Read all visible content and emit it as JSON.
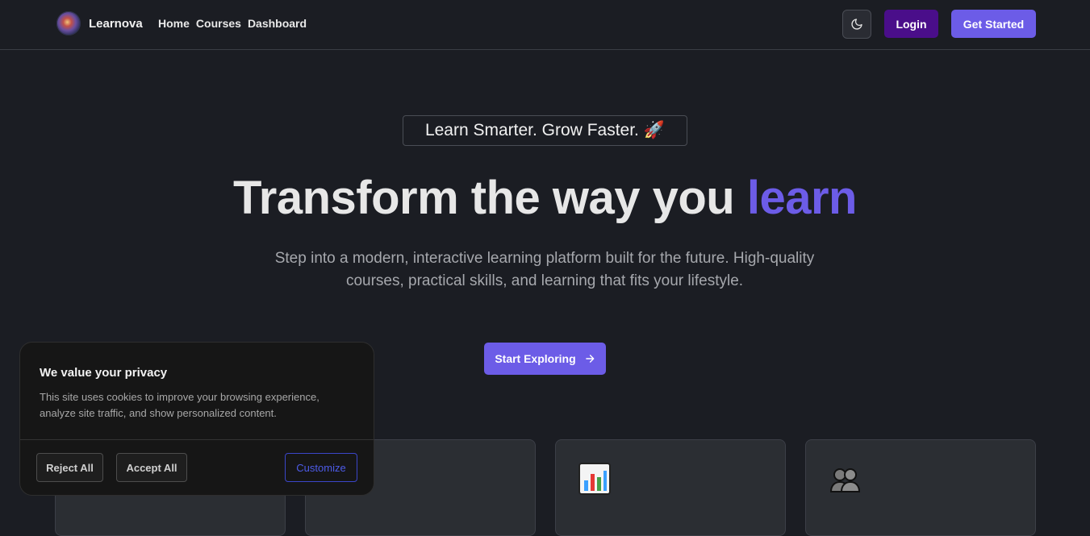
{
  "navbar": {
    "brand_name": "Learnova",
    "links": [
      "Home",
      "Courses",
      "Dashboard"
    ],
    "login_label": "Login",
    "get_started_label": "Get Started"
  },
  "hero": {
    "tagline": "Learn Smarter. Grow Faster.",
    "tagline_emoji": "🚀",
    "title_main": "Transform the way you ",
    "title_accent": "learn",
    "subtitle": "Step into a modern, interactive learning platform built for the future. High-quality courses, practical skills, and learning that fits your lifestyle.",
    "cta_label": "Start Exploring"
  },
  "cookie_banner": {
    "title": "We value your privacy",
    "text": "This site uses cookies to improve your browsing experience, analyze site traffic, and show personalized content.",
    "reject_label": "Reject All",
    "accept_label": "Accept All",
    "customize_label": "Customize"
  },
  "colors": {
    "accent": "#6c5ce7",
    "login_bg": "#4a0e8a",
    "background": "#1b1d23",
    "customize_border": "#3b46c9"
  },
  "icons": {
    "theme_toggle": "moon-icon",
    "cta_arrow": "arrow-right-icon",
    "card_2": "bar-chart-icon",
    "card_3": "users-icon"
  }
}
